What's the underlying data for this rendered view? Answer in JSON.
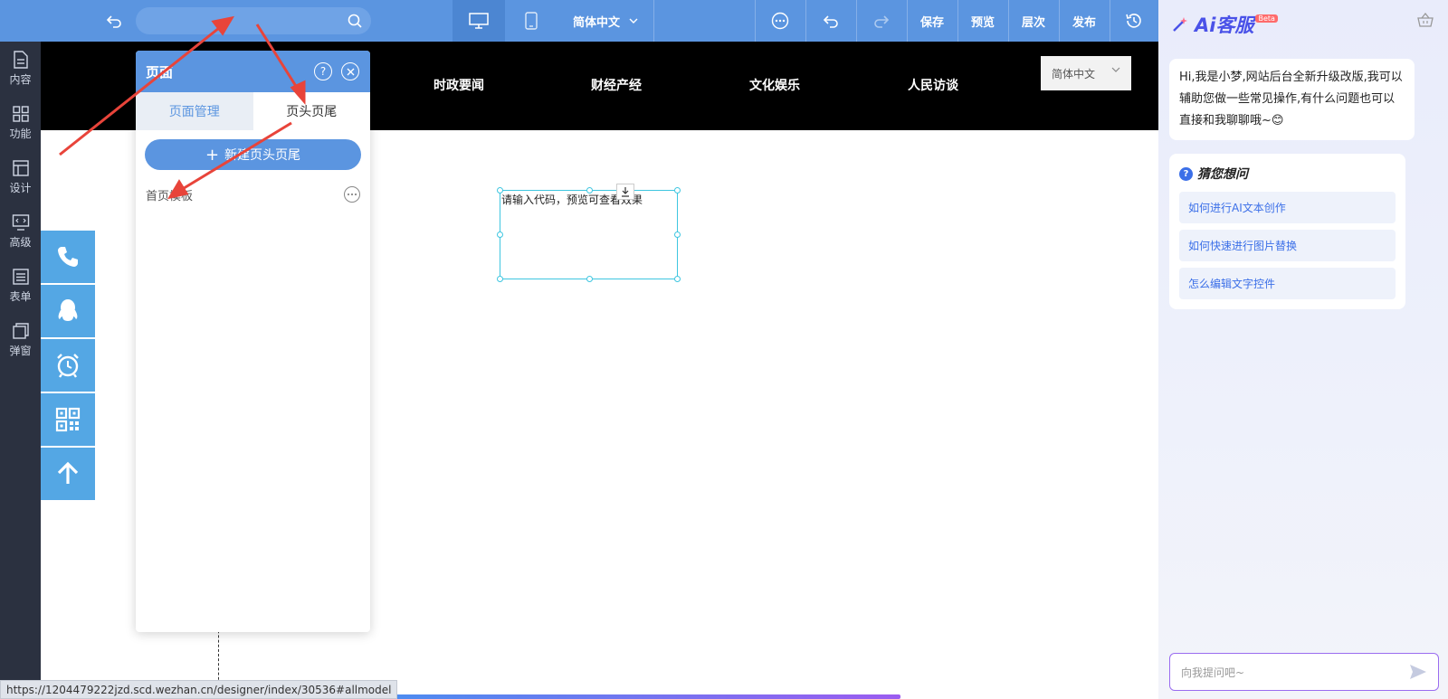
{
  "toolbar": {
    "language": "简体中文",
    "save_label": "保存",
    "preview_label": "预览",
    "layers_label": "层次",
    "publish_label": "发布",
    "search_placeholder": ""
  },
  "sidebar": {
    "items": [
      {
        "label": "内容",
        "icon": "document-icon"
      },
      {
        "label": "功能",
        "icon": "grid-icon"
      },
      {
        "label": "设计",
        "icon": "layout-icon"
      },
      {
        "label": "高级",
        "icon": "code-icon"
      },
      {
        "label": "表单",
        "icon": "form-icon"
      },
      {
        "label": "弹窗",
        "icon": "popup-icon"
      }
    ]
  },
  "site": {
    "nav": [
      "时政要闻",
      "财经产经",
      "文化娱乐",
      "人民访谈"
    ],
    "language": "简体中文",
    "code_placeholder": "请输入代码，预览可查看效果"
  },
  "panel": {
    "title": "页面",
    "help": "?",
    "tabs": [
      "页面管理",
      "页头页尾"
    ],
    "new_button": "新建页头页尾",
    "template_item": "首页模板"
  },
  "ai": {
    "logo_text": "Ai客服",
    "beta": "Beta",
    "greeting": "Hi,我是小梦,网站后台全新升级改版,我可以辅助您做一些常见操作,有什么问题也可以直接和我聊聊哦~😊",
    "guess_title": "猜您想问",
    "questions": [
      "如何进行AI文本创作",
      "如何快速进行图片替换",
      "怎么编辑文字控件"
    ],
    "input_placeholder": "向我提问吧~"
  },
  "status": {
    "url": "https://1204479222jzd.scd.wezhan.cn/designer/index/30536#allmodel"
  },
  "colors": {
    "toolbar": "#5b95e0",
    "sidebar": "#2b3140",
    "float_bar": "#54a7e4",
    "arrow": "#e8443a",
    "ai_accent": "#4a52e8"
  }
}
